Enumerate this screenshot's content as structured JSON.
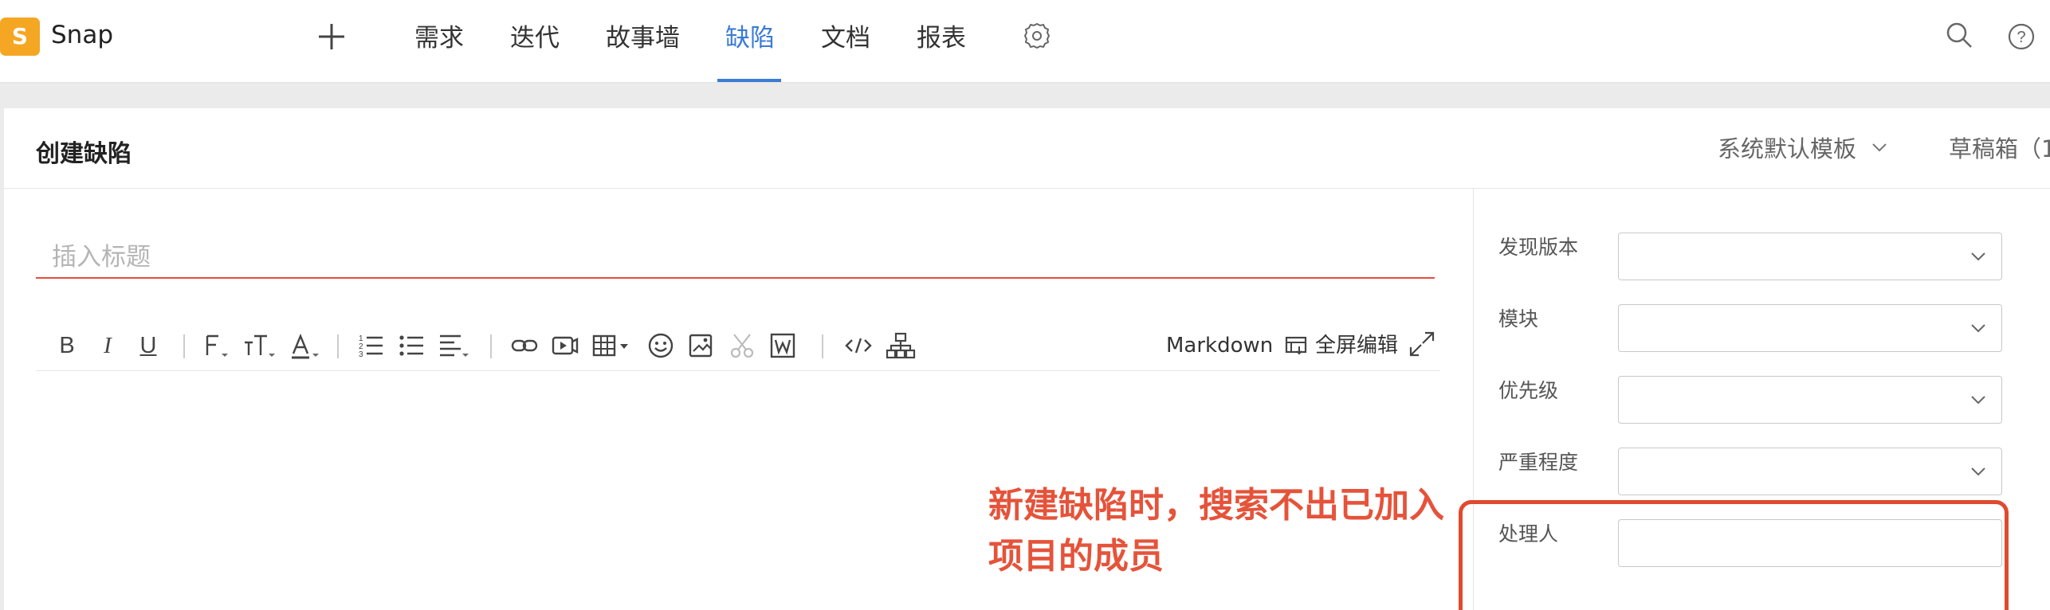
{
  "app": {
    "logo_letter": "S",
    "name": "Snap"
  },
  "nav": {
    "items": [
      {
        "label": "需求"
      },
      {
        "label": "迭代"
      },
      {
        "label": "故事墙"
      },
      {
        "label": "缺陷",
        "active": true
      },
      {
        "label": "文档"
      },
      {
        "label": "报表"
      }
    ]
  },
  "panel": {
    "title": "创建缺陷",
    "template_label": "系统默认模板",
    "drafts_label": "草稿箱（1",
    "title_placeholder": "插入标题",
    "toolbar": {
      "bold": "B",
      "italic": "I",
      "underline": "U",
      "markdown_label": "Markdown",
      "fullscreen_label": "全屏编辑"
    }
  },
  "fields": [
    {
      "label": "发现版本",
      "value": ""
    },
    {
      "label": "模块",
      "value": ""
    },
    {
      "label": "优先级",
      "value": ""
    },
    {
      "label": "严重程度",
      "value": ""
    },
    {
      "label": "处理人",
      "value": ""
    }
  ],
  "annotation": {
    "text": "新建缺陷时，搜索不出已加入项目的成员"
  },
  "colors": {
    "accent": "#3a7bd5",
    "logo": "#f5a623",
    "error_underline": "#e74c3c",
    "annotation": "#e04a2f"
  }
}
